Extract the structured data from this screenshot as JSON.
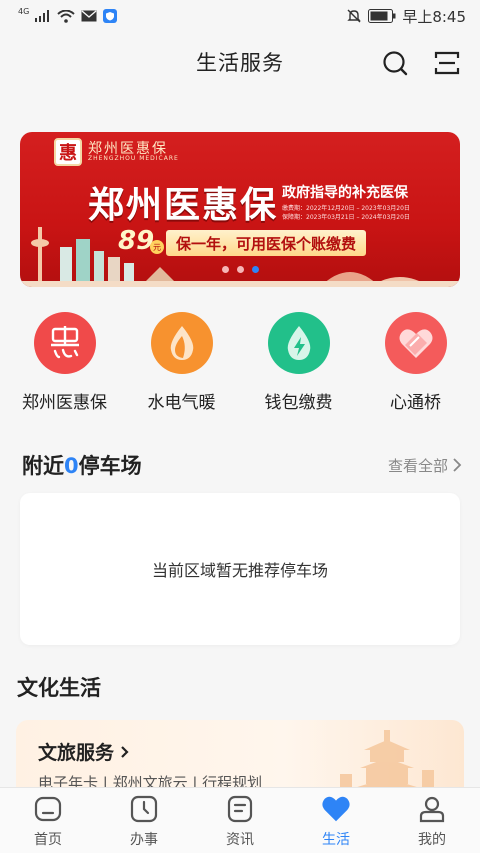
{
  "status_bar": {
    "network": "4G",
    "time": "早上8:45"
  },
  "header": {
    "title": "生活服务"
  },
  "banner": {
    "logo_char": "惠",
    "logo_text": "郑州医惠保",
    "logo_sub": "ZHENGZHOU MEDICARE",
    "headline": "郑州医惠保",
    "tagline": "政府指导的补充医保",
    "date_line1": "缴费期：2022年12月20日 – 2023年03月20日",
    "date_line2": "保障期：2023年03月21日 – 2024年03月20日",
    "price": "89",
    "price_unit": "元",
    "slogan": "保一年，可用医保个账缴费",
    "slide_count": 3,
    "active_slide": 3
  },
  "services": [
    {
      "label": "郑州医惠保",
      "icon": "huibao-icon",
      "color": "#f04a4a"
    },
    {
      "label": "水电气暖",
      "icon": "utilities-icon",
      "color": "#f7922f"
    },
    {
      "label": "钱包缴费",
      "icon": "wallet-pay-icon",
      "color": "#22c08a"
    },
    {
      "label": "心通桥",
      "icon": "heart-bridge-icon",
      "color": "#f45b5b"
    }
  ],
  "parking": {
    "title_prefix": "附近",
    "count": "0",
    "title_suffix": "停车场",
    "view_all": "查看全部",
    "empty_text": "当前区域暂无推荐停车场"
  },
  "culture": {
    "title": "文化生活",
    "card_title": "文旅服务",
    "card_sub": "电子年卡 | 郑州文旅云 | 行程规划"
  },
  "bottom_nav": [
    {
      "label": "首页",
      "icon": "home-icon"
    },
    {
      "label": "办事",
      "icon": "clock-icon"
    },
    {
      "label": "资讯",
      "icon": "news-icon"
    },
    {
      "label": "生活",
      "icon": "heart-icon",
      "active": true
    },
    {
      "label": "我的",
      "icon": "profile-icon"
    }
  ],
  "colors": {
    "accent": "#2e84f6",
    "banner_red": "#c91414"
  }
}
